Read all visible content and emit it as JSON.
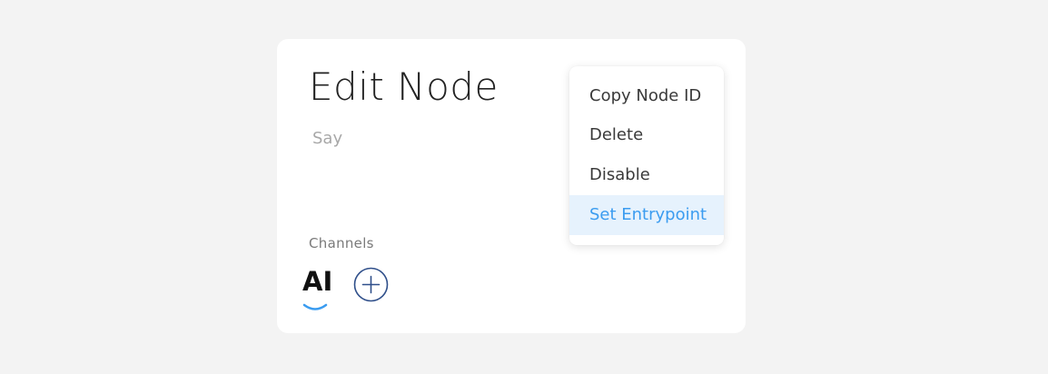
{
  "modal": {
    "title": "Edit Node",
    "say_placeholder": "Say",
    "channels_label": "Channels",
    "channels": [
      {
        "label": "AI",
        "icon": "ai-logo-icon",
        "accent": "#3b9cf0"
      }
    ],
    "add_channel_icon": "plus-circle-icon"
  },
  "context_menu": {
    "items": [
      {
        "label": "Copy Node ID"
      },
      {
        "label": "Delete"
      },
      {
        "label": "Disable"
      },
      {
        "label": "Set Entrypoint",
        "highlighted": true
      }
    ]
  },
  "colors": {
    "background": "#f3f3f3",
    "card": "#ffffff",
    "highlight_bg": "#e6f2fd",
    "highlight_text": "#3b9cf0",
    "add_icon": "#2f4f8a"
  }
}
